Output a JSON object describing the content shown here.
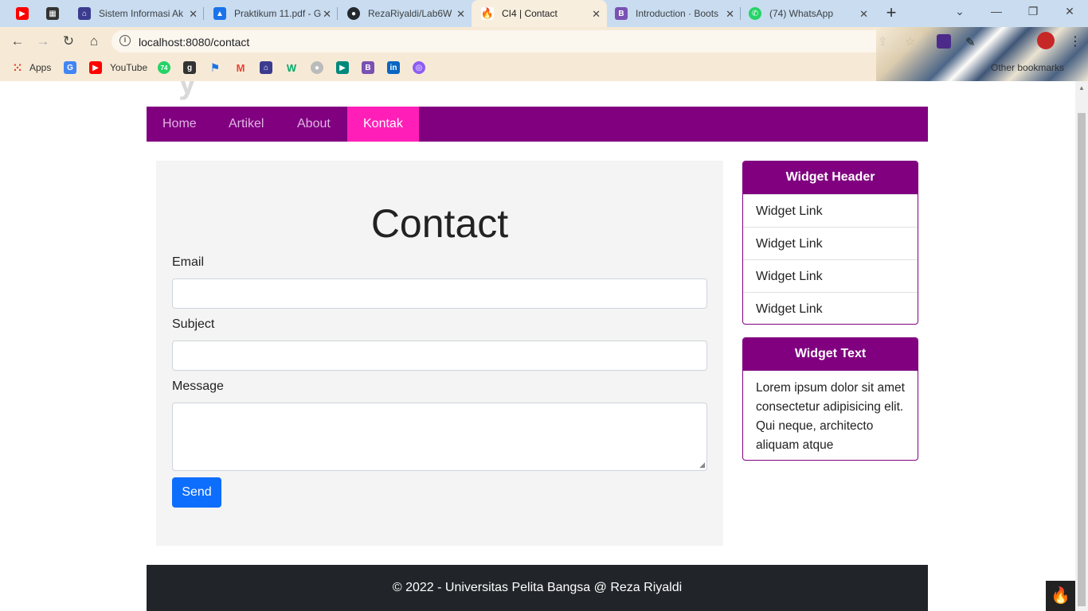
{
  "browser": {
    "tabs": [
      {
        "title": "",
        "favicon": "youtube-icon",
        "color": "#ff0000"
      },
      {
        "title": "",
        "favicon": "qr-icon",
        "color": "#333333"
      },
      {
        "title": "Sistem Informasi Ak",
        "favicon": "university-icon",
        "color": "#3b3b8f"
      },
      {
        "title": "Praktikum 11.pdf - G",
        "favicon": "drive-icon",
        "color": "#1a73e8"
      },
      {
        "title": "RezaRiyaldi/Lab6W",
        "favicon": "github-icon",
        "color": "#24292e"
      },
      {
        "title": "CI4 | Contact",
        "favicon": "codeigniter-icon",
        "color": "#e8452c"
      },
      {
        "title": "Introduction · Boots",
        "favicon": "bootstrap-icon",
        "color": "#7952b3"
      },
      {
        "title": "(74) WhatsApp",
        "favicon": "whatsapp-icon",
        "color": "#25d366"
      }
    ],
    "url": "localhost:8080/contact",
    "bookmarks": [
      {
        "label": "Apps",
        "icon": "apps-grid-icon",
        "color": "#4285f4"
      },
      {
        "label": "",
        "icon": "google-translate-icon",
        "color": "#4285f4"
      },
      {
        "label": "YouTube",
        "icon": "youtube-icon",
        "color": "#ff0000"
      },
      {
        "label": "",
        "icon": "whatsapp-icon",
        "color": "#25d366"
      },
      {
        "label": "",
        "icon": "goodreads-icon",
        "color": "#333333"
      },
      {
        "label": "",
        "icon": "flag-icon",
        "color": "#1a73e8"
      },
      {
        "label": "",
        "icon": "gmail-icon",
        "color": "#ea4335"
      },
      {
        "label": "",
        "icon": "university-icon",
        "color": "#3b3b8f"
      },
      {
        "label": "",
        "icon": "w3schools-icon",
        "color": "#04aa6d"
      },
      {
        "label": "",
        "icon": "github-icon",
        "color": "#24292e"
      },
      {
        "label": "",
        "icon": "meet-icon",
        "color": "#00897b"
      },
      {
        "label": "",
        "icon": "bootstrap-icon",
        "color": "#7952b3"
      },
      {
        "label": "",
        "icon": "linkedin-icon",
        "color": "#0a66c2"
      },
      {
        "label": "",
        "icon": "search-icon",
        "color": "#8e5cf7"
      }
    ],
    "other_bookmarks": "Other bookmarks"
  },
  "site": {
    "title_fragment": "y",
    "nav": [
      {
        "label": "Home",
        "active": false
      },
      {
        "label": "Artikel",
        "active": false
      },
      {
        "label": "About",
        "active": false
      },
      {
        "label": "Kontak",
        "active": true
      }
    ],
    "contact": {
      "heading": "Contact",
      "email_label": "Email",
      "subject_label": "Subject",
      "message_label": "Message",
      "send_label": "Send"
    },
    "widget_header": {
      "title": "Widget Header",
      "links": [
        "Widget Link",
        "Widget Link",
        "Widget Link",
        "Widget Link"
      ]
    },
    "widget_text": {
      "title": "Widget Text",
      "body": "Lorem ipsum dolor sit amet consectetur adipisicing elit. Qui neque, architecto aliquam atque"
    },
    "footer": "© 2022 - Universitas Pelita Bangsa @ Reza Riyaldi"
  },
  "colors": {
    "nav_bg": "#800080",
    "nav_active": "#ff1fb8",
    "button": "#0d6efd",
    "footer_bg": "#212529"
  }
}
